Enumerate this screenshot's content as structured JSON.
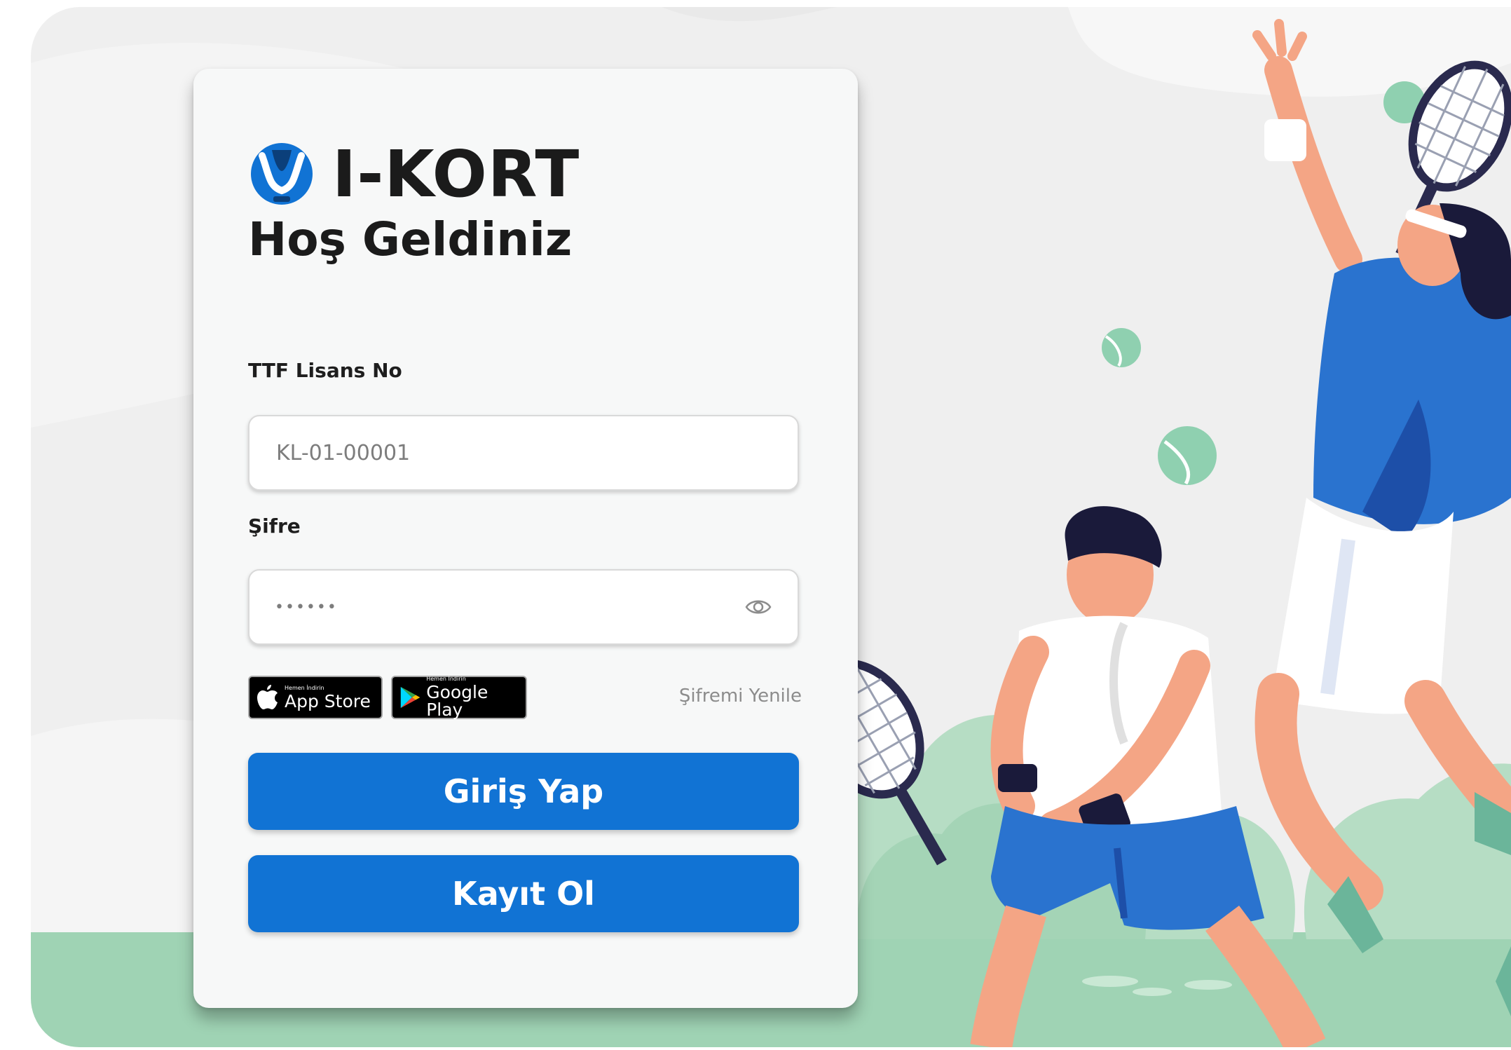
{
  "brand": {
    "name": "I-KORT",
    "welcome": "Hoş Geldiniz"
  },
  "form": {
    "license_label": "TTF Lisans No",
    "license_value": "KL-01-00001",
    "password_label": "Şifre",
    "password_value": "••••••",
    "forgot_password": "Şifremi Yenile",
    "login_button": "Giriş Yap",
    "register_button": "Kayıt Ol"
  },
  "stores": {
    "app_store_small": "Hemen İndirin",
    "app_store_big": "App Store",
    "google_play_small": "Hemen İndirin",
    "google_play_big": "Google Play"
  },
  "colors": {
    "primary": "#1173d4",
    "background": "#efefef",
    "card": "#f7f8f8"
  },
  "icons": {
    "logo": "tennis-ball-logo-icon",
    "password_toggle": "eye-icon",
    "apple": "apple-icon",
    "google_play": "google-play-icon"
  }
}
